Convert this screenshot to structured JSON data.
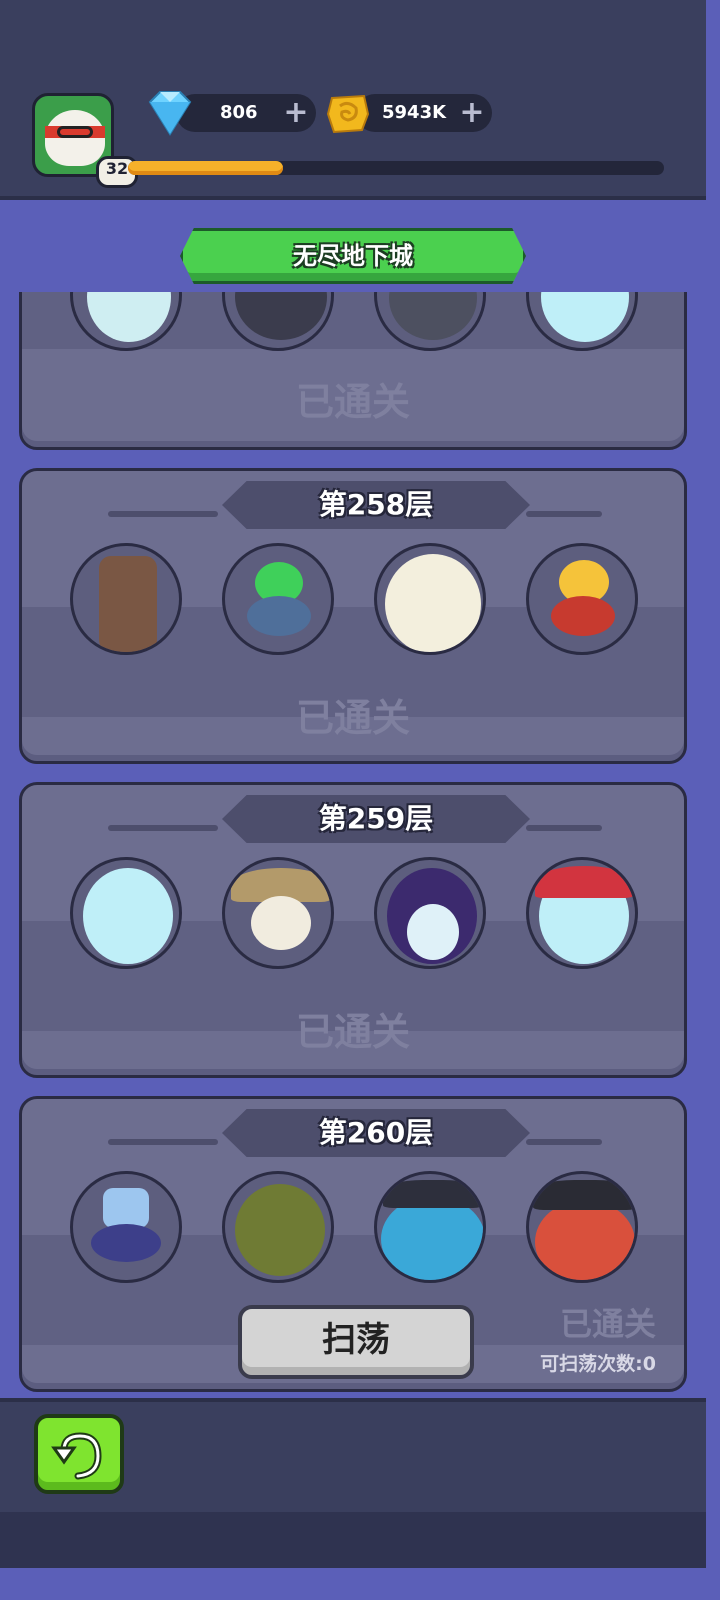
{
  "header": {
    "player_level": "32",
    "xp_progress": 0.29,
    "gems": "806",
    "gold": "5943K",
    "gems_icon": "diamond-icon",
    "gold_icon": "gold-coin-icon",
    "add_icon": "plus-icon"
  },
  "title": "无尽地下城",
  "floors": [
    {
      "label": "",
      "status": "已通关"
    },
    {
      "label": "第258层",
      "status": "已通关"
    },
    {
      "label": "第259层",
      "status": "已通关"
    },
    {
      "label": "第260层",
      "status": "已通关",
      "sweep_label": "扫荡",
      "sweep_count": "可扫荡次数:0"
    }
  ],
  "footer": {
    "back_icon": "back-arrow-icon"
  },
  "colors": {
    "accent_green": "#4bd04f",
    "xp_bar": "#f6b12a",
    "card_bg": "#6d6e90",
    "page_bg": "#5b5fb8"
  }
}
